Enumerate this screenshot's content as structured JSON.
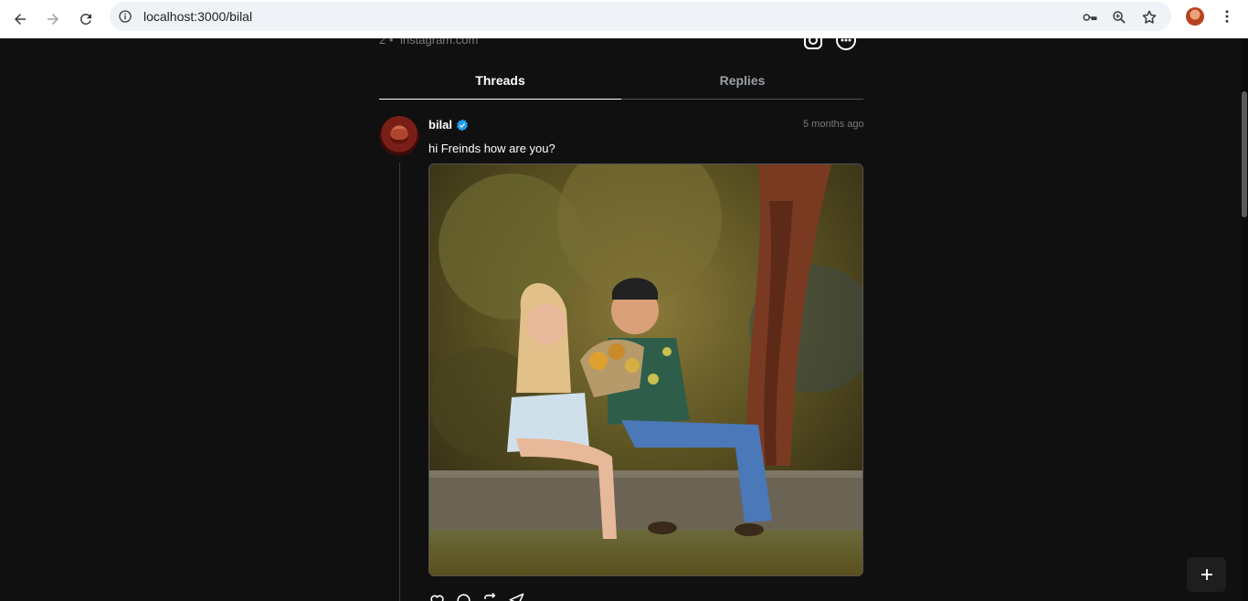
{
  "browser": {
    "url": "localhost:3000/bilal"
  },
  "profile_meta": {
    "count": "2",
    "separator": "•",
    "link": "instagram.com"
  },
  "tabs": [
    {
      "label": "Threads",
      "active": true
    },
    {
      "label": "Replies",
      "active": false
    }
  ],
  "post": {
    "username": "bilal",
    "verified": true,
    "time": "5 months ago",
    "text": "hi Freinds how are you?",
    "image_description": "photo"
  },
  "fab": {
    "icon": "plus-icon"
  },
  "colors": {
    "page_bg": "#101010",
    "verified_blue": "#1d9bf0",
    "tab_active": "#ffffff",
    "tab_inactive": "#9aa0a6"
  }
}
